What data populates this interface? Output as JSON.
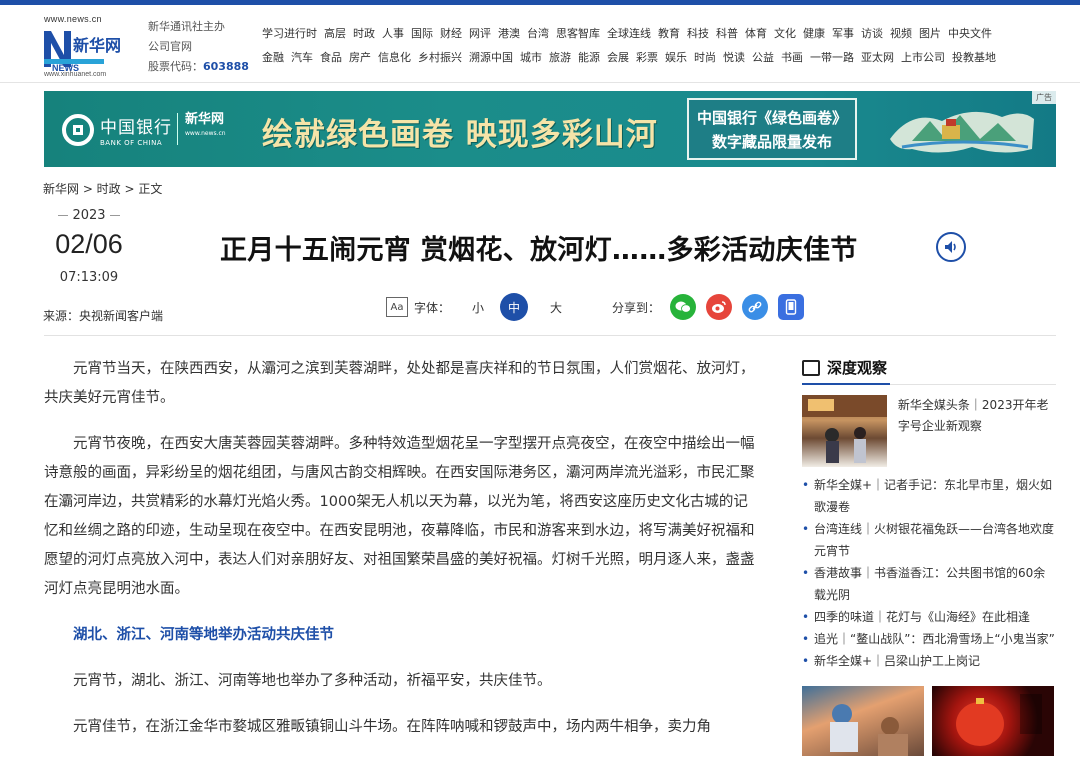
{
  "header": {
    "logo": {
      "top_url": "www.news.cn",
      "brand": "新华网",
      "brand_en": "NEWS",
      "bottom_url": "www.xinhuanet.com"
    },
    "org_line1": "新华通讯社主办",
    "org_line2": "公司官网",
    "stock_label": "股票代码：",
    "stock_code": "603888",
    "nav_row1": [
      "学习进行时",
      "高层",
      "时政",
      "人事",
      "国际",
      "财经",
      "网评",
      "港澳",
      "台湾",
      "思客智库",
      "全球连线",
      "教育",
      "科技",
      "科普",
      "体育",
      "文化",
      "健康",
      "军事",
      "访谈",
      "视频",
      "图片",
      "中央文件"
    ],
    "nav_row2": [
      "金融",
      "汽车",
      "食品",
      "房产",
      "信息化",
      "乡村振兴",
      "溯源中国",
      "城市",
      "旅游",
      "能源",
      "会展",
      "彩票",
      "娱乐",
      "时尚",
      "悦读",
      "公益",
      "书画",
      "一带一路",
      "亚太网",
      "上市公司",
      "投教基地"
    ]
  },
  "banner": {
    "bank_cn": "中国银行",
    "bank_en": "BANK OF CHINA",
    "partner": "新华网",
    "partner_url": "www.news.cn",
    "slogan": "绘就绿色画卷  映现多彩山河",
    "frame_line1": "中国银行《绿色画卷》",
    "frame_line2": "数字藏品限量发布",
    "ad_tag": "广告"
  },
  "breadcrumb": "新华网 > 时政 > 正文",
  "date": {
    "year": "2023",
    "month_day": "02/06",
    "time": "07:13:09"
  },
  "source": "来源：央视新闻客户端",
  "title": "正月十五闹元宵 赏烟花、放河灯……多彩活动庆佳节",
  "tools": {
    "aa_icon": "Aa",
    "font_label": "字体：",
    "size_small": "小",
    "size_medium": "中",
    "size_large": "大",
    "share_label": "分享到："
  },
  "article": {
    "p1": "元宵节当天，在陕西西安，从灞河之滨到芙蓉湖畔，处处都是喜庆祥和的节日氛围，人们赏烟花、放河灯，共庆美好元宵佳节。",
    "p2": "元宵节夜晚，在西安大唐芙蓉园芙蓉湖畔。多种特效造型烟花呈一字型摆开点亮夜空，在夜空中描绘出一幅诗意般的画面，异彩纷呈的烟花组团，与唐风古韵交相辉映。在西安国际港务区，灞河两岸流光溢彩，市民汇聚在灞河岸边，共赏精彩的水幕灯光焰火秀。1000架无人机以天为幕，以光为笔，将西安这座历史文化古城的记忆和丝绸之路的印迹，生动呈现在夜空中。在西安昆明池，夜幕降临，市民和游客来到水边，将写满美好祝福和愿望的河灯点亮放入河中，表达人们对亲朋好友、对祖国繁荣昌盛的美好祝福。灯树千光照，明月逐人来，盏盏河灯点亮昆明池水面。",
    "subheading": "湖北、浙江、河南等地举办活动共庆佳节",
    "p3": "元宵节，湖北、浙江、河南等地也举办了多种活动，祈福平安，共庆佳节。",
    "p4": "元宵佳节，在浙江金华市婺城区雅畈镇铜山斗牛场。在阵阵呐喊和锣鼓声中，场内两牛相争，卖力角"
  },
  "sidebar": {
    "heading": "深度观察",
    "feature_text": "新华全媒头条｜2023开年老字号企业新观察",
    "items": [
      "新华全媒+｜记者手记：东北早市里，烟火如歌漫卷",
      "台湾连线｜火树银花福兔跃——台湾各地欢度元宵节",
      "香港故事｜书香溢香江：公共图书馆的60余载光阴",
      "四季的味道｜花灯与《山海经》在此相逢",
      "追光｜“鳌山战队”：西北滑雪场上“小鬼当家”",
      "新华全媒+｜吕梁山护工上岗记"
    ]
  },
  "colors": {
    "brand_blue": "#1e4fa8",
    "banner_teal": "#1a8a8e",
    "gold": "#f5e4a8"
  }
}
